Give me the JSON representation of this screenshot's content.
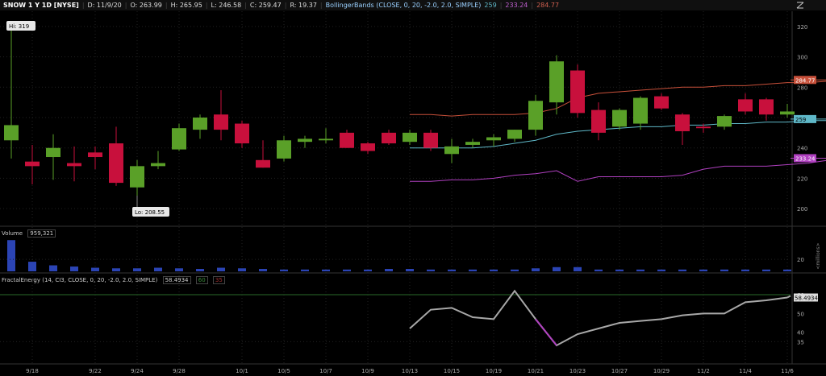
{
  "header": {
    "symbol": "SNOW 1 Y 1D [NYSE]",
    "date": "D: 11/9/20",
    "open": "O: 263.99",
    "high": "H: 265.95",
    "low": "L: 246.58",
    "close": "C: 259.47",
    "range": "R: 19.37",
    "study": "BollingerBands (CLOSE, 0, 20, -2.0, 2.0, SIMPLE)",
    "mid": "259",
    "lower": "233.24",
    "upper": "284.77"
  },
  "colors": {
    "up": "#5aa028",
    "down": "#c8103c",
    "mid_band": "#5fb8c8",
    "upper_band": "#c8503a",
    "lower_band": "#b040c0",
    "volume": "#2b44b4",
    "fractal": "#a8a8a8",
    "fractal_down": "#b040c0"
  },
  "volume_pane": {
    "label": "Volume",
    "value": "959,321",
    "axis_unit": "<millions>"
  },
  "fractal_pane": {
    "label": "FractalEnergy (14, CI3, CLOSE, 0, 20, -2.0, 2.0, SIMPLE)",
    "value": "58.4934",
    "level_high": "60",
    "level_low": "35"
  },
  "chart_data": [
    {
      "type": "candlestick",
      "title": "SNOW 1 Y 1D [NYSE]",
      "ylim": [
        190,
        330
      ],
      "yticks": [
        "200",
        "220",
        "240",
        "260",
        "280",
        "300",
        "320"
      ],
      "xtick_labels": [
        {
          "i": 1,
          "label": "9/18"
        },
        {
          "i": 4,
          "label": "9/22"
        },
        {
          "i": 6,
          "label": "9/24"
        },
        {
          "i": 8,
          "label": "9/28"
        },
        {
          "i": 11,
          "label": "10/1"
        },
        {
          "i": 13,
          "label": "10/5"
        },
        {
          "i": 15,
          "label": "10/7"
        },
        {
          "i": 17,
          "label": "10/9"
        },
        {
          "i": 19,
          "label": "10/13"
        },
        {
          "i": 21,
          "label": "10/15"
        },
        {
          "i": 23,
          "label": "10/19"
        },
        {
          "i": 25,
          "label": "10/21"
        },
        {
          "i": 27,
          "label": "10/23"
        },
        {
          "i": 29,
          "label": "10/27"
        },
        {
          "i": 31,
          "label": "10/29"
        },
        {
          "i": 33,
          "label": "11/2"
        },
        {
          "i": 35,
          "label": "11/4"
        },
        {
          "i": 37,
          "label": "11/6"
        }
      ],
      "candles": [
        {
          "o": 245,
          "h": 319,
          "l": 233,
          "c": 255
        },
        {
          "o": 231,
          "h": 242,
          "l": 216,
          "c": 228
        },
        {
          "o": 234,
          "h": 249,
          "l": 219,
          "c": 240
        },
        {
          "o": 230,
          "h": 241,
          "l": 218,
          "c": 228
        },
        {
          "o": 237,
          "h": 241,
          "l": 226,
          "c": 234
        },
        {
          "o": 243,
          "h": 254,
          "l": 215,
          "c": 217
        },
        {
          "o": 214,
          "h": 232,
          "l": 208.55,
          "c": 228
        },
        {
          "o": 228,
          "h": 238,
          "l": 226,
          "c": 230
        },
        {
          "o": 239,
          "h": 256,
          "l": 238,
          "c": 253
        },
        {
          "o": 252,
          "h": 262,
          "l": 246,
          "c": 260
        },
        {
          "o": 262,
          "h": 278,
          "l": 245,
          "c": 252
        },
        {
          "o": 256,
          "h": 258,
          "l": 240,
          "c": 243
        },
        {
          "o": 232,
          "h": 245,
          "l": 227,
          "c": 227
        },
        {
          "o": 233,
          "h": 248,
          "l": 231,
          "c": 245
        },
        {
          "o": 244,
          "h": 248,
          "l": 240,
          "c": 246
        },
        {
          "o": 245,
          "h": 253,
          "l": 243,
          "c": 246
        },
        {
          "o": 250,
          "h": 252,
          "l": 240,
          "c": 240
        },
        {
          "o": 243,
          "h": 244,
          "l": 236,
          "c": 238
        },
        {
          "o": 250,
          "h": 252,
          "l": 242,
          "c": 243
        },
        {
          "o": 244,
          "h": 252,
          "l": 242,
          "c": 250
        },
        {
          "o": 250,
          "h": 252,
          "l": 238,
          "c": 240
        },
        {
          "o": 236,
          "h": 246,
          "l": 230,
          "c": 241
        },
        {
          "o": 242,
          "h": 246,
          "l": 240,
          "c": 244
        },
        {
          "o": 245,
          "h": 249,
          "l": 241,
          "c": 247
        },
        {
          "o": 246,
          "h": 252,
          "l": 244,
          "c": 252
        },
        {
          "o": 252,
          "h": 275,
          "l": 248,
          "c": 271
        },
        {
          "o": 270,
          "h": 301,
          "l": 262,
          "c": 297
        },
        {
          "o": 291,
          "h": 295,
          "l": 260,
          "c": 263
        },
        {
          "o": 265,
          "h": 270,
          "l": 245,
          "c": 250
        },
        {
          "o": 254,
          "h": 266,
          "l": 252,
          "c": 265
        },
        {
          "o": 256,
          "h": 274,
          "l": 252,
          "c": 273
        },
        {
          "o": 274,
          "h": 276,
          "l": 265,
          "c": 266
        },
        {
          "o": 262,
          "h": 263,
          "l": 242,
          "c": 251
        },
        {
          "o": 254,
          "h": 256,
          "l": 250,
          "c": 253
        },
        {
          "o": 254,
          "h": 262,
          "l": 252,
          "c": 261
        },
        {
          "o": 272,
          "h": 276,
          "l": 262,
          "c": 264
        },
        {
          "o": 272,
          "h": 273,
          "l": 258,
          "c": 262
        },
        {
          "o": 262,
          "h": 269,
          "l": 260,
          "c": 264
        }
      ],
      "bands": {
        "start": 19,
        "upper": [
          262,
          262,
          261,
          262,
          262,
          262,
          263,
          266,
          273,
          276,
          277,
          278,
          279,
          280,
          280,
          281,
          281,
          282,
          283,
          283,
          284,
          284.77
        ],
        "mid": [
          240,
          240,
          240,
          240,
          241,
          243,
          245,
          249,
          251,
          252,
          253,
          254,
          254,
          255,
          255,
          256,
          256,
          257,
          257,
          258,
          258,
          259
        ],
        "lower": [
          218,
          218,
          219,
          219,
          220,
          222,
          223,
          225,
          218,
          221,
          221,
          221,
          221,
          222,
          226,
          228,
          228,
          228,
          229,
          230,
          232,
          233.24
        ]
      },
      "price_labels": {
        "hi": "Hi: 319",
        "lo": "Lo: 208.55",
        "mid": "259",
        "upper": "284.77",
        "lower": "233.24"
      }
    },
    {
      "type": "bar",
      "title": "Volume",
      "yticks": [
        "20"
      ],
      "values": [
        52,
        16,
        10,
        8,
        6,
        5,
        5,
        6,
        5,
        4,
        6,
        5,
        4,
        3,
        3,
        3,
        3,
        3,
        4,
        4,
        3,
        3,
        3,
        3,
        3,
        5,
        7,
        7,
        3,
        3,
        3,
        3,
        3,
        3,
        3,
        3,
        3,
        3
      ]
    },
    {
      "type": "line",
      "title": "FractalEnergy (14, CI3, CLOSE, 0, 20, -2.0, 2.0, SIMPLE)",
      "ylim": [
        24,
        66
      ],
      "yticks": [
        "35",
        "40",
        "50",
        "60"
      ],
      "start": 19,
      "values": [
        42,
        52,
        53,
        48,
        47,
        62,
        47,
        33,
        39,
        42,
        45,
        46,
        47,
        49,
        50,
        50,
        56,
        57,
        58.4934
      ]
    }
  ]
}
